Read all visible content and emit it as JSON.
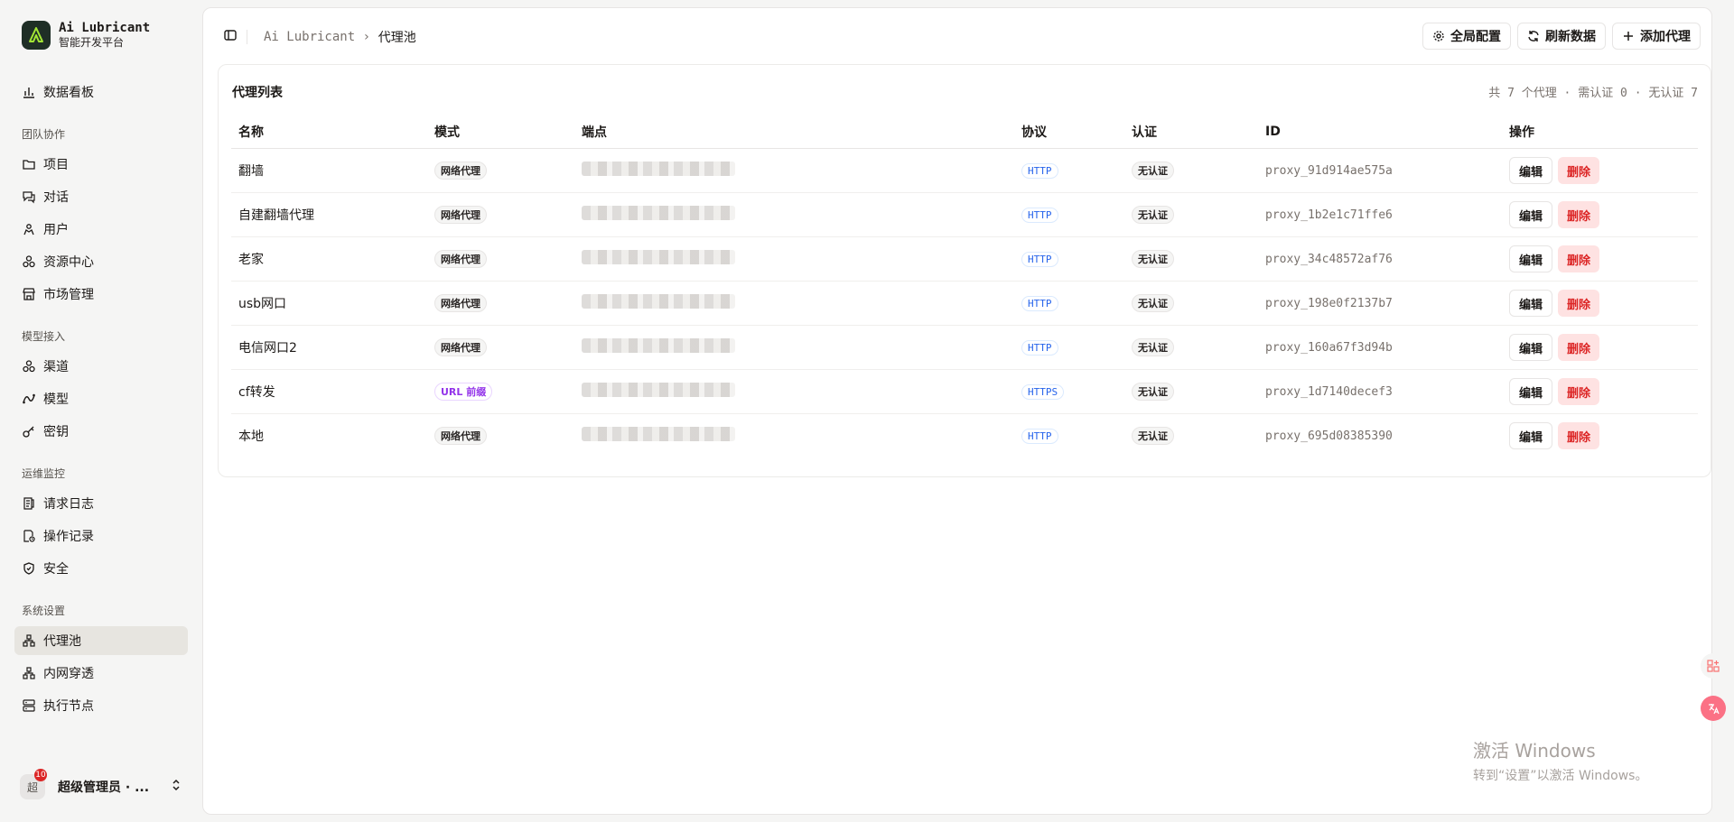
{
  "brand": {
    "name": "Ai Lubricant",
    "subtitle": "智能开发平台"
  },
  "nav": {
    "top": [
      {
        "label": "数据看板",
        "icon": "bar-chart-icon"
      }
    ],
    "groups": [
      {
        "label": "团队协作",
        "items": [
          {
            "label": "项目",
            "icon": "folder-icon"
          },
          {
            "label": "对话",
            "icon": "chat-icon"
          },
          {
            "label": "用户",
            "icon": "users-icon"
          },
          {
            "label": "资源中心",
            "icon": "resources-icon"
          },
          {
            "label": "市场管理",
            "icon": "store-icon"
          }
        ]
      },
      {
        "label": "模型接入",
        "items": [
          {
            "label": "渠道",
            "icon": "channel-icon"
          },
          {
            "label": "模型",
            "icon": "model-icon"
          },
          {
            "label": "密钥",
            "icon": "key-icon"
          }
        ]
      },
      {
        "label": "运维监控",
        "items": [
          {
            "label": "请求日志",
            "icon": "log-icon"
          },
          {
            "label": "操作记录",
            "icon": "record-icon"
          },
          {
            "label": "安全",
            "icon": "shield-icon"
          }
        ]
      },
      {
        "label": "系统设置",
        "items": [
          {
            "label": "代理池",
            "icon": "network-icon",
            "active": true
          },
          {
            "label": "内网穿透",
            "icon": "network-icon"
          },
          {
            "label": "执行节点",
            "icon": "server-icon"
          }
        ]
      }
    ]
  },
  "user": {
    "avatar": "超",
    "badge": "10",
    "name": "超级管理员 · ..."
  },
  "breadcrumb": {
    "root": "Ai Lubricant",
    "separator": "›",
    "current": "代理池"
  },
  "toolbar": {
    "global_config": "全局配置",
    "refresh": "刷新数据",
    "add": "添加代理"
  },
  "card": {
    "title": "代理列表",
    "summary": "共 7 个代理 · 需认证 0 · 无认证 7",
    "columns": [
      "名称",
      "模式",
      "端点",
      "协议",
      "认证",
      "ID",
      "操作"
    ],
    "rows": [
      {
        "name": "翻墙",
        "mode": "网络代理",
        "mode_type": "net",
        "protocol": "HTTP",
        "auth": "无认证",
        "id": "proxy_91d914ae575a"
      },
      {
        "name": "自建翻墙代理",
        "mode": "网络代理",
        "mode_type": "net",
        "protocol": "HTTP",
        "auth": "无认证",
        "id": "proxy_1b2e1c71ffe6"
      },
      {
        "name": "老家",
        "mode": "网络代理",
        "mode_type": "net",
        "protocol": "HTTP",
        "auth": "无认证",
        "id": "proxy_34c48572af76"
      },
      {
        "name": "usb网口",
        "mode": "网络代理",
        "mode_type": "net",
        "protocol": "HTTP",
        "auth": "无认证",
        "id": "proxy_198e0f2137b7"
      },
      {
        "name": "电信网口2",
        "mode": "网络代理",
        "mode_type": "net",
        "protocol": "HTTP",
        "auth": "无认证",
        "id": "proxy_160a67f3d94b"
      },
      {
        "name": "cf转发",
        "mode": "URL 前缀",
        "mode_type": "url",
        "protocol": "HTTPS",
        "auth": "无认证",
        "id": "proxy_1d7140decef3"
      },
      {
        "name": "本地",
        "mode": "网络代理",
        "mode_type": "net",
        "protocol": "HTTP",
        "auth": "无认证",
        "id": "proxy_695d08385390"
      }
    ],
    "edit_label": "编辑",
    "delete_label": "删除"
  },
  "watermark": {
    "line1": "激活 Windows",
    "line2": "转到“设置”以激活 Windows。"
  }
}
